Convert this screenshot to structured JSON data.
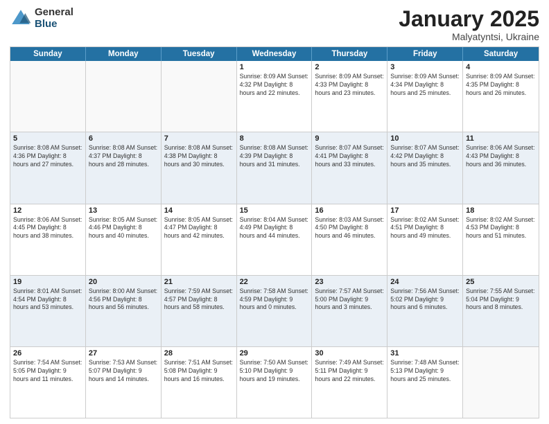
{
  "logo": {
    "general": "General",
    "blue": "Blue"
  },
  "title": {
    "month": "January 2025",
    "location": "Malyatyntsi, Ukraine"
  },
  "days_header": [
    "Sunday",
    "Monday",
    "Tuesday",
    "Wednesday",
    "Thursday",
    "Friday",
    "Saturday"
  ],
  "weeks": [
    [
      {
        "day": "",
        "detail": "",
        "empty": true
      },
      {
        "day": "",
        "detail": "",
        "empty": true
      },
      {
        "day": "",
        "detail": "",
        "empty": true
      },
      {
        "day": "1",
        "detail": "Sunrise: 8:09 AM\nSunset: 4:32 PM\nDaylight: 8 hours\nand 22 minutes.",
        "empty": false
      },
      {
        "day": "2",
        "detail": "Sunrise: 8:09 AM\nSunset: 4:33 PM\nDaylight: 8 hours\nand 23 minutes.",
        "empty": false
      },
      {
        "day": "3",
        "detail": "Sunrise: 8:09 AM\nSunset: 4:34 PM\nDaylight: 8 hours\nand 25 minutes.",
        "empty": false
      },
      {
        "day": "4",
        "detail": "Sunrise: 8:09 AM\nSunset: 4:35 PM\nDaylight: 8 hours\nand 26 minutes.",
        "empty": false
      }
    ],
    [
      {
        "day": "5",
        "detail": "Sunrise: 8:08 AM\nSunset: 4:36 PM\nDaylight: 8 hours\nand 27 minutes.",
        "empty": false
      },
      {
        "day": "6",
        "detail": "Sunrise: 8:08 AM\nSunset: 4:37 PM\nDaylight: 8 hours\nand 28 minutes.",
        "empty": false
      },
      {
        "day": "7",
        "detail": "Sunrise: 8:08 AM\nSunset: 4:38 PM\nDaylight: 8 hours\nand 30 minutes.",
        "empty": false
      },
      {
        "day": "8",
        "detail": "Sunrise: 8:08 AM\nSunset: 4:39 PM\nDaylight: 8 hours\nand 31 minutes.",
        "empty": false
      },
      {
        "day": "9",
        "detail": "Sunrise: 8:07 AM\nSunset: 4:41 PM\nDaylight: 8 hours\nand 33 minutes.",
        "empty": false
      },
      {
        "day": "10",
        "detail": "Sunrise: 8:07 AM\nSunset: 4:42 PM\nDaylight: 8 hours\nand 35 minutes.",
        "empty": false
      },
      {
        "day": "11",
        "detail": "Sunrise: 8:06 AM\nSunset: 4:43 PM\nDaylight: 8 hours\nand 36 minutes.",
        "empty": false
      }
    ],
    [
      {
        "day": "12",
        "detail": "Sunrise: 8:06 AM\nSunset: 4:45 PM\nDaylight: 8 hours\nand 38 minutes.",
        "empty": false
      },
      {
        "day": "13",
        "detail": "Sunrise: 8:05 AM\nSunset: 4:46 PM\nDaylight: 8 hours\nand 40 minutes.",
        "empty": false
      },
      {
        "day": "14",
        "detail": "Sunrise: 8:05 AM\nSunset: 4:47 PM\nDaylight: 8 hours\nand 42 minutes.",
        "empty": false
      },
      {
        "day": "15",
        "detail": "Sunrise: 8:04 AM\nSunset: 4:49 PM\nDaylight: 8 hours\nand 44 minutes.",
        "empty": false
      },
      {
        "day": "16",
        "detail": "Sunrise: 8:03 AM\nSunset: 4:50 PM\nDaylight: 8 hours\nand 46 minutes.",
        "empty": false
      },
      {
        "day": "17",
        "detail": "Sunrise: 8:02 AM\nSunset: 4:51 PM\nDaylight: 8 hours\nand 49 minutes.",
        "empty": false
      },
      {
        "day": "18",
        "detail": "Sunrise: 8:02 AM\nSunset: 4:53 PM\nDaylight: 8 hours\nand 51 minutes.",
        "empty": false
      }
    ],
    [
      {
        "day": "19",
        "detail": "Sunrise: 8:01 AM\nSunset: 4:54 PM\nDaylight: 8 hours\nand 53 minutes.",
        "empty": false
      },
      {
        "day": "20",
        "detail": "Sunrise: 8:00 AM\nSunset: 4:56 PM\nDaylight: 8 hours\nand 56 minutes.",
        "empty": false
      },
      {
        "day": "21",
        "detail": "Sunrise: 7:59 AM\nSunset: 4:57 PM\nDaylight: 8 hours\nand 58 minutes.",
        "empty": false
      },
      {
        "day": "22",
        "detail": "Sunrise: 7:58 AM\nSunset: 4:59 PM\nDaylight: 9 hours\nand 0 minutes.",
        "empty": false
      },
      {
        "day": "23",
        "detail": "Sunrise: 7:57 AM\nSunset: 5:00 PM\nDaylight: 9 hours\nand 3 minutes.",
        "empty": false
      },
      {
        "day": "24",
        "detail": "Sunrise: 7:56 AM\nSunset: 5:02 PM\nDaylight: 9 hours\nand 6 minutes.",
        "empty": false
      },
      {
        "day": "25",
        "detail": "Sunrise: 7:55 AM\nSunset: 5:04 PM\nDaylight: 9 hours\nand 8 minutes.",
        "empty": false
      }
    ],
    [
      {
        "day": "26",
        "detail": "Sunrise: 7:54 AM\nSunset: 5:05 PM\nDaylight: 9 hours\nand 11 minutes.",
        "empty": false
      },
      {
        "day": "27",
        "detail": "Sunrise: 7:53 AM\nSunset: 5:07 PM\nDaylight: 9 hours\nand 14 minutes.",
        "empty": false
      },
      {
        "day": "28",
        "detail": "Sunrise: 7:51 AM\nSunset: 5:08 PM\nDaylight: 9 hours\nand 16 minutes.",
        "empty": false
      },
      {
        "day": "29",
        "detail": "Sunrise: 7:50 AM\nSunset: 5:10 PM\nDaylight: 9 hours\nand 19 minutes.",
        "empty": false
      },
      {
        "day": "30",
        "detail": "Sunrise: 7:49 AM\nSunset: 5:11 PM\nDaylight: 9 hours\nand 22 minutes.",
        "empty": false
      },
      {
        "day": "31",
        "detail": "Sunrise: 7:48 AM\nSunset: 5:13 PM\nDaylight: 9 hours\nand 25 minutes.",
        "empty": false
      },
      {
        "day": "",
        "detail": "",
        "empty": true
      }
    ]
  ]
}
